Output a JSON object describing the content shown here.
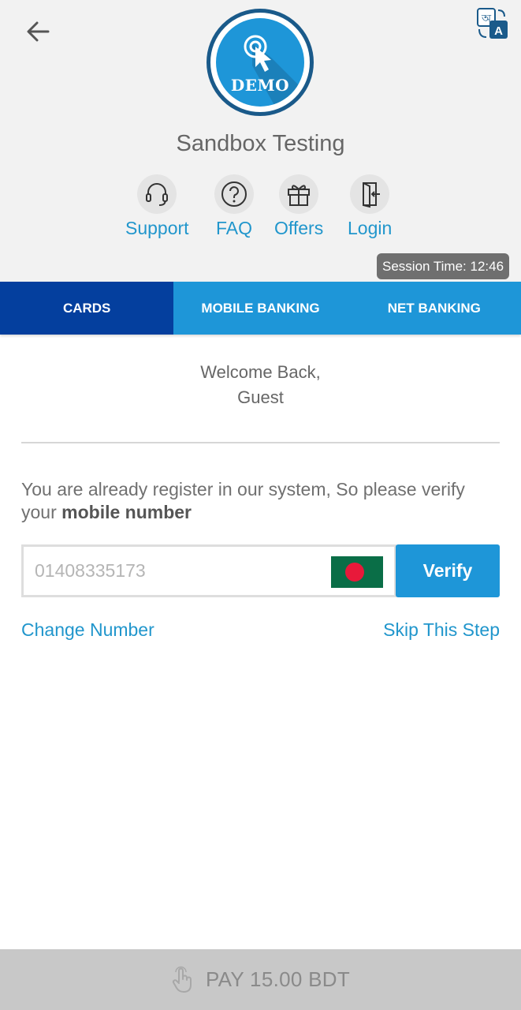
{
  "header": {
    "merchant_name": "Sandbox Testing",
    "logo_text": "DEMO",
    "quick_links": [
      {
        "label": "Support",
        "icon": "headset-icon"
      },
      {
        "label": "FAQ",
        "icon": "question-icon"
      },
      {
        "label": "Offers",
        "icon": "gift-icon"
      },
      {
        "label": "Login",
        "icon": "login-door-icon"
      }
    ],
    "session_time": "Session Time: 12:46"
  },
  "tabs": [
    {
      "label": "CARDS",
      "active": true
    },
    {
      "label": "MOBILE BANKING",
      "active": false
    },
    {
      "label": "NET BANKING",
      "active": false
    }
  ],
  "welcome": {
    "line1": "Welcome Back,",
    "line2": "Guest"
  },
  "verify": {
    "message_prefix": "You are already register in our system, So please verify your ",
    "message_bold": "mobile number",
    "phone_placeholder": "01408335173",
    "button_label": "Verify",
    "change_number": "Change Number",
    "skip_step": "Skip This Step"
  },
  "pay": {
    "label": "PAY 15.00 BDT"
  },
  "colors": {
    "accent": "#1e96d8",
    "active_tab": "#043f9e",
    "link": "#2196cc",
    "header_bg": "#f2f2f2",
    "pay_bar": "#c8c8c8"
  }
}
